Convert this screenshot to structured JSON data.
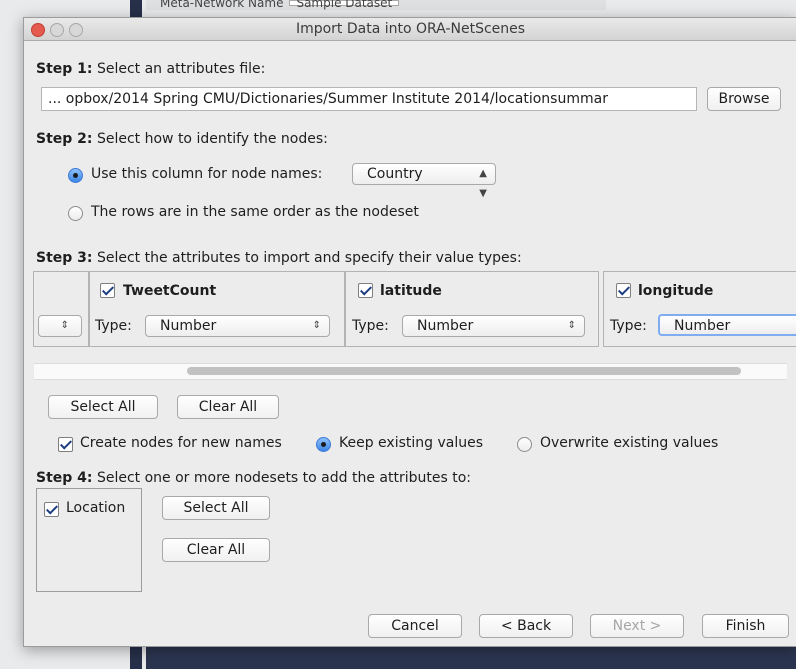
{
  "background": {
    "top_label": "Meta-Network Name",
    "top_value": "Sample Dataset"
  },
  "window": {
    "title": "Import Data into ORA-NetScenes"
  },
  "step1": {
    "label_bold": "Step 1:",
    "label_text": " Select an attributes file:",
    "file_path": "... opbox/2014 Spring CMU/Dictionaries/Summer Institute 2014/locationsummar",
    "browse_label": "Browse"
  },
  "step2": {
    "label_bold": "Step 2:",
    "label_text": " Select how to identify the nodes:",
    "option_column": "Use this column for node names:",
    "column_value": "Country",
    "option_order": "The rows are in the same order as the nodeset",
    "selected": "column"
  },
  "step3": {
    "label_bold": "Step 3:",
    "label_text": " Select the attributes to import and specify their value types:",
    "attributes": [
      {
        "name": "TweetCount",
        "checked": true,
        "type_label": "Type:",
        "type_value": "Number"
      },
      {
        "name": "latitude",
        "checked": true,
        "type_label": "Type:",
        "type_value": "Number"
      },
      {
        "name": "longitude",
        "checked": true,
        "type_label": "Type:",
        "type_value": "Number"
      }
    ],
    "select_all": "Select All",
    "clear_all": "Clear All",
    "create_nodes": "Create nodes for new names",
    "keep_existing": "Keep existing values",
    "overwrite_existing": "Overwrite existing values",
    "selected_merge": "keep"
  },
  "step4": {
    "label_bold": "Step 4:",
    "label_text": " Select one or more nodesets to add the attributes to:",
    "nodesets": [
      {
        "name": "Location",
        "checked": true
      }
    ],
    "select_all": "Select All",
    "clear_all": "Clear All"
  },
  "footer": {
    "cancel": "Cancel",
    "back": "< Back",
    "next": "Next >",
    "finish": "Finish"
  }
}
